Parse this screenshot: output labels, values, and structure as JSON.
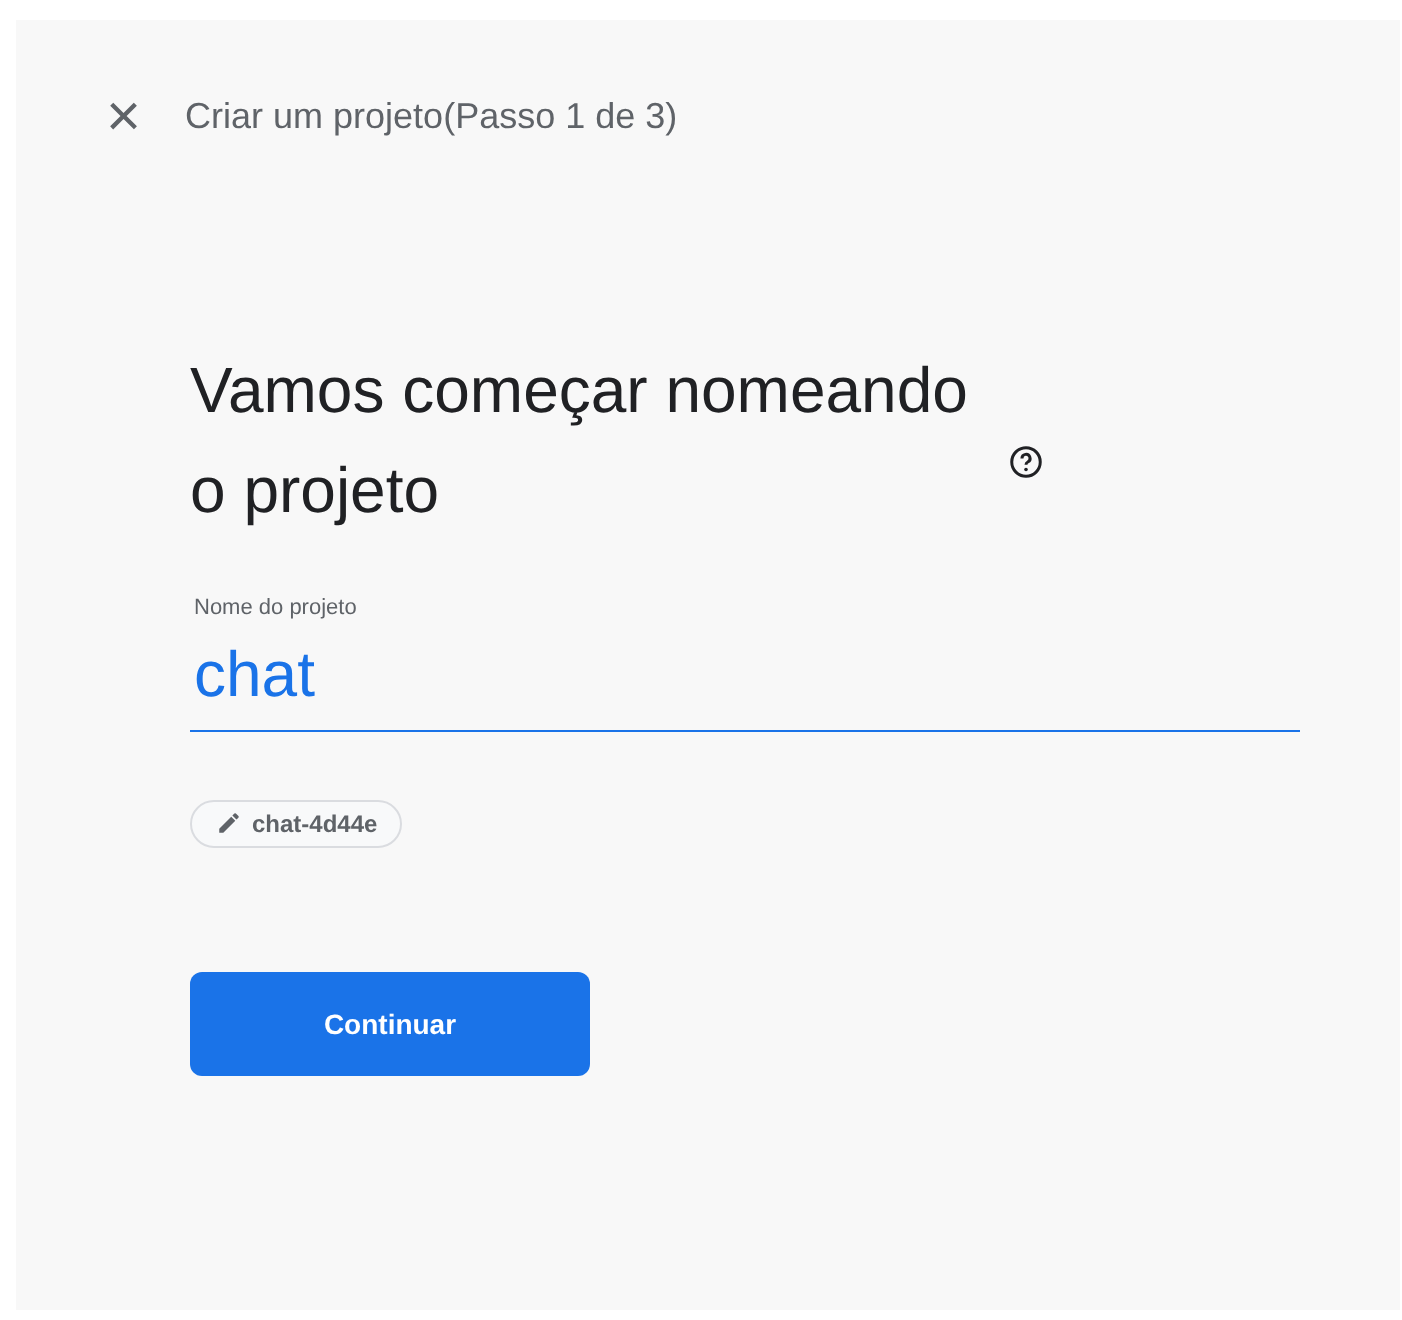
{
  "header": {
    "close": "×",
    "title": "Criar um projeto(Passo 1 de 3)"
  },
  "heading": "Vamos começar nomeando o projeto",
  "field": {
    "label": "Nome do projeto",
    "value": "chat"
  },
  "project_id_chip": "chat-4d44e",
  "buttons": [
    "Continuar"
  ]
}
